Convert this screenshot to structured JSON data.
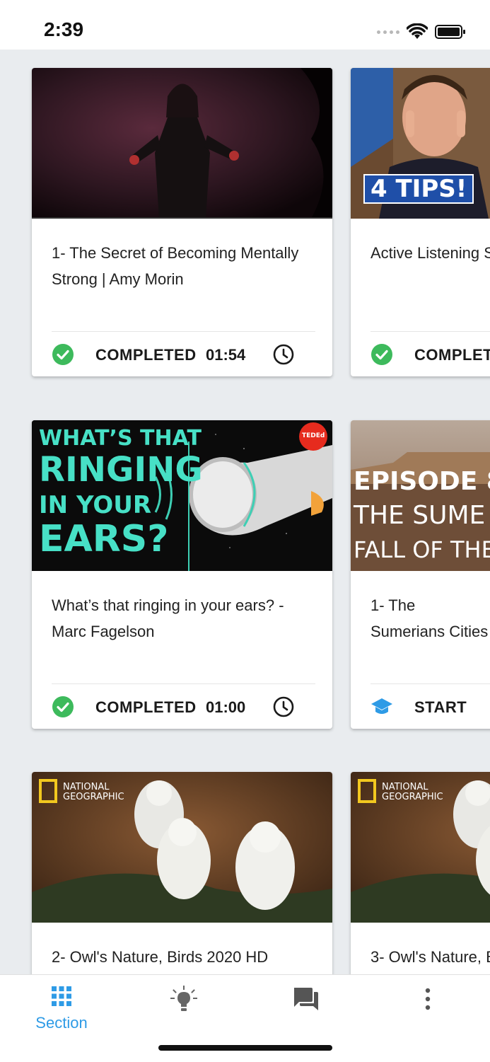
{
  "status_bar": {
    "time": "2:39"
  },
  "rows": [
    {
      "cards": [
        {
          "title": "1- The Secret of Becoming Mentally Strong | Amy Morin",
          "status": "COMPLETED",
          "duration": "01:54"
        },
        {
          "title": "Active Listening S",
          "status": "COMPLET",
          "thumb_text": "4 TIPS!"
        }
      ]
    },
    {
      "cards": [
        {
          "title": "What’s that ringing in your ears? - Marc Fagelson",
          "status": "COMPLETED",
          "duration": "01:00",
          "thumb_text": {
            "l1": "WHAT’S THAT",
            "l2": "RINGING",
            "l3": "IN YOUR",
            "l4": "EARS?",
            "badge": "TEDEd"
          }
        },
        {
          "title": "1- The Sumerians Cities",
          "status": "START",
          "thumb_text": {
            "l1": "EPISODE 8",
            "l2": "THE SUME",
            "l3": "FALL OF THE"
          }
        }
      ]
    },
    {
      "cards": [
        {
          "title": "2- Owl's Nature, Birds 2020 HD",
          "thumb_text": {
            "brand1": "NATIONAL",
            "brand2": "GEOGRAPHIC"
          }
        },
        {
          "title": "3- Owl's Nature, B",
          "thumb_text": {
            "brand1": "NATIONAL",
            "brand2": "GEOGRAPHIC"
          }
        }
      ]
    }
  ],
  "bottom_nav": {
    "items": [
      {
        "label": "Section",
        "icon": "grid-icon",
        "active": true
      },
      {
        "label": "",
        "icon": "lightbulb-icon"
      },
      {
        "label": "",
        "icon": "chat-icon"
      },
      {
        "label": "",
        "icon": "more-vert-icon"
      }
    ]
  },
  "colors": {
    "accent": "#2e9be6",
    "completed_green": "#3dba5c",
    "background": "#e9ecef"
  }
}
